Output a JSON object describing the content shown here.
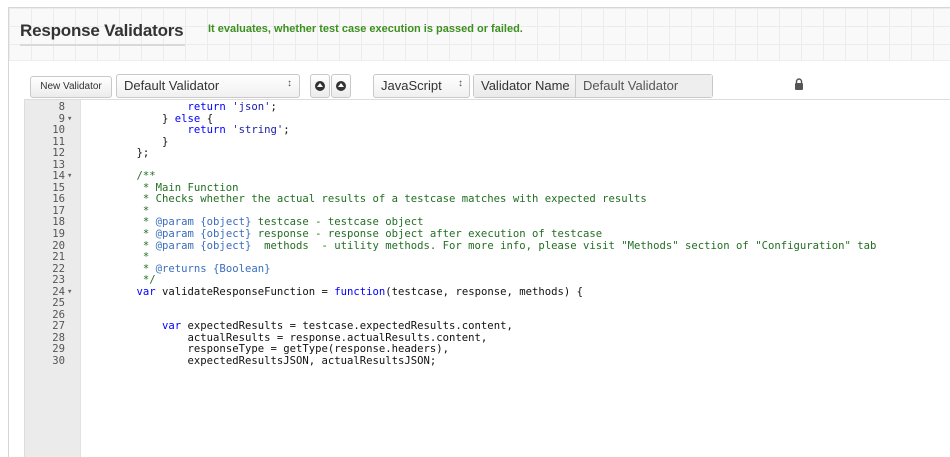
{
  "header": {
    "title": "Response Validators",
    "subtitle": "It evaluates, whether test case execution is passed or failed."
  },
  "toolbar": {
    "new_validator_label": "New Validator",
    "validator_select_value": "Default Validator",
    "select_caret": "↕",
    "move_up_icon": "circle-arrow-up-icon",
    "move_down_icon": "circle-arrow-down-icon",
    "language_select_value": "JavaScript",
    "validator_name_label": "Validator Name",
    "validator_name_value": "Default Validator",
    "lock_icon": "lock-icon"
  },
  "editor": {
    "lines": [
      {
        "num": "8",
        "fold": "",
        "indent": "            ",
        "tokens": [
          [
            "kw",
            "return "
          ],
          [
            "str",
            "'json'"
          ],
          [
            "plain",
            ";"
          ]
        ]
      },
      {
        "num": "9",
        "fold": "▾",
        "indent": "        ",
        "tokens": [
          [
            "plain",
            "} "
          ],
          [
            "kw",
            "else"
          ],
          [
            "plain",
            " {"
          ]
        ]
      },
      {
        "num": "10",
        "fold": "",
        "indent": "            ",
        "tokens": [
          [
            "kw",
            "return "
          ],
          [
            "str",
            "'string'"
          ],
          [
            "plain",
            ";"
          ]
        ]
      },
      {
        "num": "11",
        "fold": "",
        "indent": "        ",
        "tokens": [
          [
            "plain",
            "}"
          ]
        ]
      },
      {
        "num": "12",
        "fold": "",
        "indent": "    ",
        "tokens": [
          [
            "plain",
            "};"
          ]
        ]
      },
      {
        "num": "13",
        "fold": "",
        "indent": "",
        "tokens": []
      },
      {
        "num": "14",
        "fold": "▾",
        "indent": "    ",
        "tokens": [
          [
            "cm",
            "/**"
          ]
        ]
      },
      {
        "num": "15",
        "fold": "",
        "indent": "     ",
        "tokens": [
          [
            "cm",
            "* Main Function"
          ]
        ]
      },
      {
        "num": "16",
        "fold": "",
        "indent": "     ",
        "tokens": [
          [
            "cm",
            "* Checks whether the actual results of a testcase matches with expected results"
          ]
        ]
      },
      {
        "num": "17",
        "fold": "",
        "indent": "     ",
        "tokens": [
          [
            "cm",
            "*"
          ]
        ]
      },
      {
        "num": "18",
        "fold": "",
        "indent": "     ",
        "tokens": [
          [
            "cm",
            "* "
          ],
          [
            "doc",
            "@param {object}"
          ],
          [
            "cm",
            " testcase - testcase object"
          ]
        ]
      },
      {
        "num": "19",
        "fold": "",
        "indent": "     ",
        "tokens": [
          [
            "cm",
            "* "
          ],
          [
            "doc",
            "@param {object}"
          ],
          [
            "cm",
            " response - response object after execution of testcase"
          ]
        ]
      },
      {
        "num": "20",
        "fold": "",
        "indent": "     ",
        "tokens": [
          [
            "cm",
            "* "
          ],
          [
            "doc",
            "@param {object}"
          ],
          [
            "cm",
            "  methods  - utility methods. For more info, please visit \"Methods\" section of \"Configuration\" tab"
          ]
        ]
      },
      {
        "num": "21",
        "fold": "",
        "indent": "     ",
        "tokens": [
          [
            "cm",
            "*"
          ]
        ]
      },
      {
        "num": "22",
        "fold": "",
        "indent": "     ",
        "tokens": [
          [
            "cm",
            "* "
          ],
          [
            "doc",
            "@returns {Boolean}"
          ]
        ]
      },
      {
        "num": "23",
        "fold": "",
        "indent": "     ",
        "tokens": [
          [
            "cm",
            "*/"
          ]
        ]
      },
      {
        "num": "24",
        "fold": "▾",
        "indent": "    ",
        "tokens": [
          [
            "kw",
            "var "
          ],
          [
            "plain",
            "validateResponseFunction = "
          ],
          [
            "kw",
            "function"
          ],
          [
            "plain",
            "(testcase, response, methods) {"
          ]
        ]
      },
      {
        "num": "25",
        "fold": "",
        "indent": "",
        "tokens": []
      },
      {
        "num": "26",
        "fold": "",
        "indent": "",
        "tokens": []
      },
      {
        "num": "27",
        "fold": "",
        "indent": "        ",
        "tokens": [
          [
            "kw",
            "var "
          ],
          [
            "plain",
            "expectedResults = testcase.expectedResults.content,"
          ]
        ]
      },
      {
        "num": "28",
        "fold": "",
        "indent": "            ",
        "tokens": [
          [
            "plain",
            "actualResults = response.actualResults.content,"
          ]
        ]
      },
      {
        "num": "29",
        "fold": "",
        "indent": "            ",
        "tokens": [
          [
            "plain",
            "responseType = getType(response.headers),"
          ]
        ]
      },
      {
        "num": "30",
        "fold": "",
        "indent": "            ",
        "tokens": [
          [
            "plain",
            "expectedResultsJSON, actualResultsJSON;"
          ]
        ]
      }
    ]
  }
}
